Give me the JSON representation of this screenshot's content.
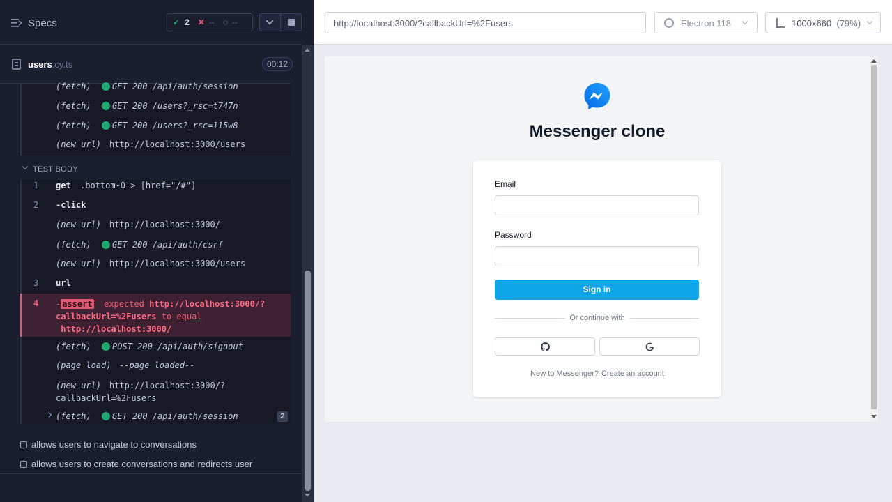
{
  "reporter": {
    "specs_label": "Specs",
    "stats": {
      "passed": "2",
      "failed": "--",
      "pending": "--"
    },
    "spec": {
      "name": "users",
      "ext": ".cy.ts",
      "time": "00:12"
    },
    "hooks_rows": [
      {
        "cmd": "(fetch)",
        "msg": "GET 200 /api/auth/session",
        "dot": true
      },
      {
        "cmd": "(fetch)",
        "msg": "GET 200 /users?_rsc=t747n",
        "dot": true
      },
      {
        "cmd": "(fetch)",
        "msg": "GET 200 /users?_rsc=115w8",
        "dot": true
      },
      {
        "cmd": "(new url)",
        "msg": "http://localhost:3000/users",
        "dot": false
      }
    ],
    "section_label": "TEST BODY",
    "body_rows": [
      {
        "ln": "1",
        "cmd": "get",
        "msg": ".bottom-0 > [href=\"/#\"]"
      },
      {
        "ln": "2",
        "cmd": "-click",
        "msg": ""
      },
      {
        "ln": "",
        "cmd": "(new url)",
        "msg": "http://localhost:3000/"
      },
      {
        "ln": "",
        "cmd": "(fetch)",
        "msg": "GET 200 /api/auth/csrf"
      },
      {
        "ln": "",
        "cmd": "(new url)",
        "msg": "http://localhost:3000/users"
      },
      {
        "ln": "3",
        "cmd": "url",
        "msg": ""
      }
    ],
    "fail": {
      "ln": "4",
      "dash": "-",
      "badge": "assert",
      "expected": "expected",
      "url1a": "http://localhost:3000/?",
      "url1b": "callbackUrl=%2Fusers",
      "to_equal": "to equal",
      "url2": "http://localhost:3000/"
    },
    "after_rows": [
      {
        "cmd": "(fetch)",
        "msg": "POST 200 /api/auth/signout"
      },
      {
        "cmd": "(page load)",
        "msg": "--page loaded--"
      },
      {
        "cmd": "(new url)",
        "msg": "http://localhost:3000/?",
        "msg2": "callbackUrl=%2Fusers"
      },
      {
        "cmd": "(fetch)",
        "msg": "GET 200 /api/auth/session",
        "count": "2"
      }
    ],
    "tests": [
      "allows users to navigate to conversations",
      "allows users to create conversations and redirects user"
    ]
  },
  "aut": {
    "url": "http://localhost:3000/?callbackUrl=%2Fusers",
    "browser": "Electron 118",
    "viewport": "1000x660",
    "zoom": "(79%)",
    "app": {
      "title": "Messenger clone",
      "email_label": "Email",
      "password_label": "Password",
      "signin_label": "Sign in",
      "or_text": "Or continue with",
      "footer_prefix": "New to Messenger?",
      "footer_link": "Create an account"
    }
  },
  "colors": {
    "pass": "#1fa971",
    "fail": "#f25a72",
    "accent": "#0ea5e9",
    "messenger": "#0a7cff"
  }
}
